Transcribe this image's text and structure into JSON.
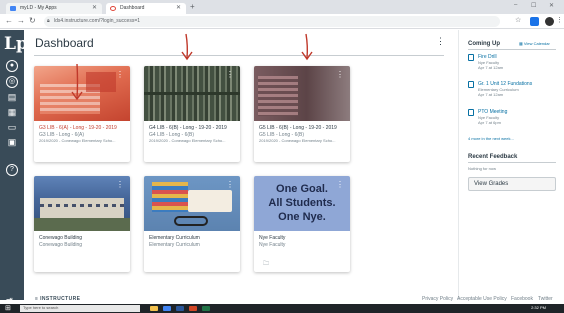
{
  "browser": {
    "tabs": [
      {
        "title": "myLD - My Apps",
        "favicon_color": "#4285f4"
      },
      {
        "title": "Dashboard",
        "favicon_color": "#e0463a"
      }
    ],
    "new_tab": "+",
    "address": "lds4.instructure.com/?login_success=1",
    "win_min": "–",
    "win_max": "☐",
    "win_close": "✕"
  },
  "global_nav": {
    "logo": "Lp",
    "items": [
      {
        "name": "account",
        "glyph": "●"
      },
      {
        "name": "dashboard",
        "glyph": "◎"
      },
      {
        "name": "courses",
        "glyph": "▤"
      },
      {
        "name": "calendar",
        "glyph": "▦"
      },
      {
        "name": "inbox",
        "glyph": "▭"
      },
      {
        "name": "help",
        "glyph": "?"
      }
    ],
    "collapse": "⇥"
  },
  "dashboard": {
    "title": "Dashboard",
    "menu": "⋮"
  },
  "cards": [
    {
      "title": "G3 LIB - 6(A) - Long - 19-20 - 2019",
      "subtitle": "G3 LIB - Long - 6(A)",
      "term": "2019/2020 - Conewago Elementary Scho...",
      "title_color": "#c23c2d",
      "hero": "#e06b4f"
    },
    {
      "title": "G4 LIB - 6(B) - Long - 19-20 - 2019",
      "subtitle": "G4 LIB - Long - 6(B)",
      "term": "2019/2020 - Conewago Elementary Scho...",
      "title_color": "#2d3b45",
      "hero": "#5e6b5b"
    },
    {
      "title": "G5 LIB - 6(B) - Long - 19-20 - 2019",
      "subtitle": "G5 LIB - Long - 6(B)",
      "term": "2019/2020 - Conewago Elementary Scho...",
      "title_color": "#2d3b45",
      "hero": "#6e4f52"
    },
    {
      "title": "Conewago Building",
      "subtitle": "Conewago Building",
      "term": "",
      "title_color": "#2d3b45",
      "hero": "#3f5f8a"
    },
    {
      "title": "Elementary Curriculum",
      "subtitle": "Elementary Curriculum",
      "term": "",
      "title_color": "#2d3b45",
      "hero": "#5c83b0"
    },
    {
      "title": "Nye Faculty",
      "subtitle": "Nye Faculty",
      "term": "",
      "title_color": "#2d3b45",
      "hero": "#8fa7d6",
      "hero_text": [
        "One Goal.",
        "All Students.",
        "One Nye."
      ]
    }
  ],
  "sidebar": {
    "coming_up": "Coming Up",
    "view_calendar": "View Calendar",
    "todos": [
      {
        "title": "Fire Drill",
        "meta": [
          "Nye Faculty",
          "Apr 7 at 12am"
        ]
      },
      {
        "title": "Gr. 1 Unit 12 Fundations",
        "meta": [
          "Elementary Curriculum",
          "Apr 7 at 12am"
        ]
      },
      {
        "title": "PTO Meeting",
        "meta": [
          "Nye Faculty",
          "Apr 7 at 6pm"
        ]
      }
    ],
    "more_link": "4 more in the next week...",
    "recent_feedback": "Recent Feedback",
    "nothing": "Nothing for now",
    "view_grades": "View Grades"
  },
  "footer": {
    "logo": "≡ INSTRUCTURE",
    "links": [
      "Privacy Policy",
      "Acceptable Use Policy",
      "Facebook",
      "Twitter"
    ]
  },
  "taskbar": {
    "search_hint": "Type here to search",
    "clock": "2:32 PM"
  },
  "annotation_color": "#c0392b",
  "accent": "#0770a3"
}
